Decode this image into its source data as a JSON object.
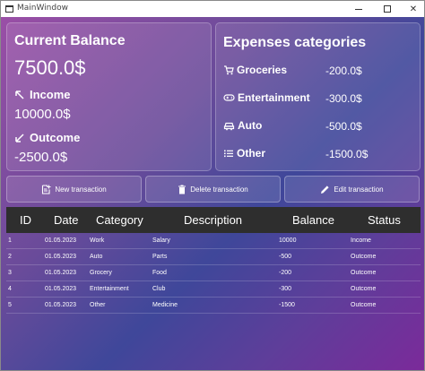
{
  "window": {
    "title": "MainWindow"
  },
  "balance": {
    "heading": "Current Balance",
    "amount": "7500.0$",
    "income_label": "Income",
    "income_value": "10000.0$",
    "outcome_label": "Outcome",
    "outcome_value": "-2500.0$"
  },
  "expenses": {
    "heading": "Expenses categories",
    "items": [
      {
        "label": "Groceries",
        "value": "-200.0$",
        "icon": "cart-icon"
      },
      {
        "label": "Entertainment",
        "value": "-300.0$",
        "icon": "gamepad-icon"
      },
      {
        "label": "Auto",
        "value": "-500.0$",
        "icon": "car-icon"
      },
      {
        "label": "Other",
        "value": "-1500.0$",
        "icon": "list-icon"
      }
    ]
  },
  "toolbar": {
    "new_label": "New transaction",
    "delete_label": "Delete transaction",
    "edit_label": "Edit transaction"
  },
  "table": {
    "columns": [
      "ID",
      "Date",
      "Category",
      "Description",
      "Balance",
      "Status"
    ],
    "rows": [
      [
        "1",
        "01.05.2023",
        "Work",
        "Salary",
        "10000",
        "Income"
      ],
      [
        "2",
        "01.05.2023",
        "Auto",
        "Parts",
        "-500",
        "Outcome"
      ],
      [
        "3",
        "01.05.2023",
        "Grocery",
        "Food",
        "-200",
        "Outcome"
      ],
      [
        "4",
        "01.05.2023",
        "Entertainment",
        "Club",
        "-300",
        "Outcome"
      ],
      [
        "5",
        "01.05.2023",
        "Other",
        "Medicine",
        "-1500",
        "Outcome"
      ]
    ]
  }
}
